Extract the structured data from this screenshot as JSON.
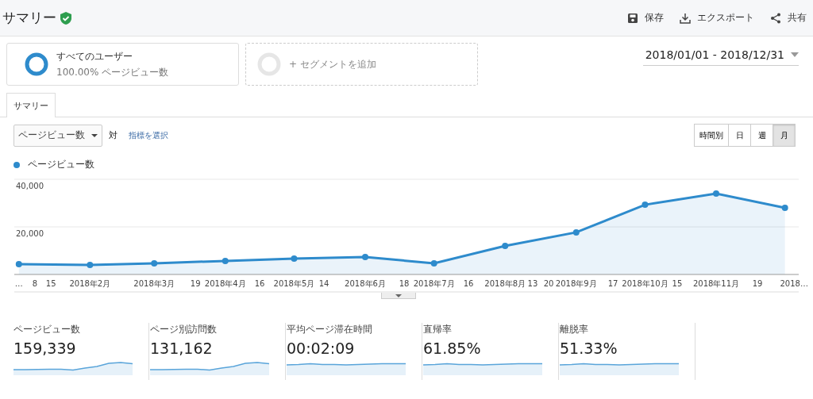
{
  "header": {
    "title": "サマリー",
    "verified": true,
    "actions": [
      {
        "kind": "save",
        "label": "保存"
      },
      {
        "kind": "export",
        "label": "エクスポート"
      },
      {
        "kind": "share",
        "label": "共有"
      }
    ]
  },
  "segments": [
    {
      "kind": "active",
      "name": "すべてのユーザー",
      "detail": "100.00% ページビュー数"
    },
    {
      "kind": "add",
      "name": "+ セグメントを追加"
    }
  ],
  "date_range": "2018/01/01 - 2018/12/31",
  "tabs": [
    {
      "label": "サマリー",
      "selected": true
    }
  ],
  "metric_select": {
    "value": "ページビュー数"
  },
  "versus": "対",
  "choose_metric_link": "指標を選択",
  "granularity": [
    {
      "label": "時間別",
      "selected": false
    },
    {
      "label": "日",
      "selected": false
    },
    {
      "label": "週",
      "selected": false
    },
    {
      "label": "月",
      "selected": true
    }
  ],
  "chart_data": {
    "type": "area",
    "xlim": [
      "2017-12-30",
      "2018-12-07"
    ],
    "x": [
      "2018-01-01",
      "2018-02-01",
      "2018-03-01",
      "2018-04-01",
      "2018-05-01",
      "2018-06-01",
      "2018-07-01",
      "2018-08-01",
      "2018-09-01",
      "2018-10-01",
      "2018-11-01",
      "2018-12-01"
    ],
    "series": [
      {
        "name": "ページビュー数",
        "color": "#2e8bcc",
        "values": [
          4300,
          4000,
          4700,
          5700,
          6700,
          7300,
          4700,
          12000,
          17700,
          29300,
          34000,
          28000
        ]
      }
    ],
    "ylim": [
      0,
      40000
    ],
    "yticks": [
      {
        "value": 20000,
        "label": "20,000"
      },
      {
        "value": 40000,
        "label": "40,000"
      }
    ],
    "xticks": [
      {
        "value": "2018-01-01",
        "label": "…"
      },
      {
        "value": "2018-01-08",
        "label": "8"
      },
      {
        "value": "2018-01-15",
        "label": "15"
      },
      {
        "value": "2018-02-01",
        "label": "2018年2月"
      },
      {
        "value": "2018-03-01",
        "label": "2018年3月"
      },
      {
        "value": "2018-03-19",
        "label": "19"
      },
      {
        "value": "2018-04-01",
        "label": "2018年4月"
      },
      {
        "value": "2018-04-16",
        "label": "16"
      },
      {
        "value": "2018-05-01",
        "label": "2018年5月"
      },
      {
        "value": "2018-05-14",
        "label": "14"
      },
      {
        "value": "2018-06-01",
        "label": "2018年6月"
      },
      {
        "value": "2018-06-18",
        "label": "18"
      },
      {
        "value": "2018-07-01",
        "label": "2018年7月"
      },
      {
        "value": "2018-07-16",
        "label": "16"
      },
      {
        "value": "2018-08-01",
        "label": "2018年8月"
      },
      {
        "value": "2018-08-13",
        "label": "13"
      },
      {
        "value": "2018-08-20",
        "label": "20"
      },
      {
        "value": "2018-09-01",
        "label": "2018年9月"
      },
      {
        "value": "2018-09-17",
        "label": "17"
      },
      {
        "value": "2018-10-01",
        "label": "2018年10月"
      },
      {
        "value": "2018-10-15",
        "label": "15"
      },
      {
        "value": "2018-11-01",
        "label": "2018年11月"
      },
      {
        "value": "2018-11-19",
        "label": "19"
      },
      {
        "value": "2018-12-05",
        "label": "2018…"
      }
    ]
  },
  "metrics": [
    {
      "label": "ページビュー数",
      "value": "159,339"
    },
    {
      "label": "ページ別訪問数",
      "value": "131,162"
    },
    {
      "label": "平均ページ滞在時間",
      "value": "00:02:09"
    },
    {
      "label": "直帰率",
      "value": "61.85%"
    },
    {
      "label": "離脱率",
      "value": "51.33%"
    }
  ]
}
